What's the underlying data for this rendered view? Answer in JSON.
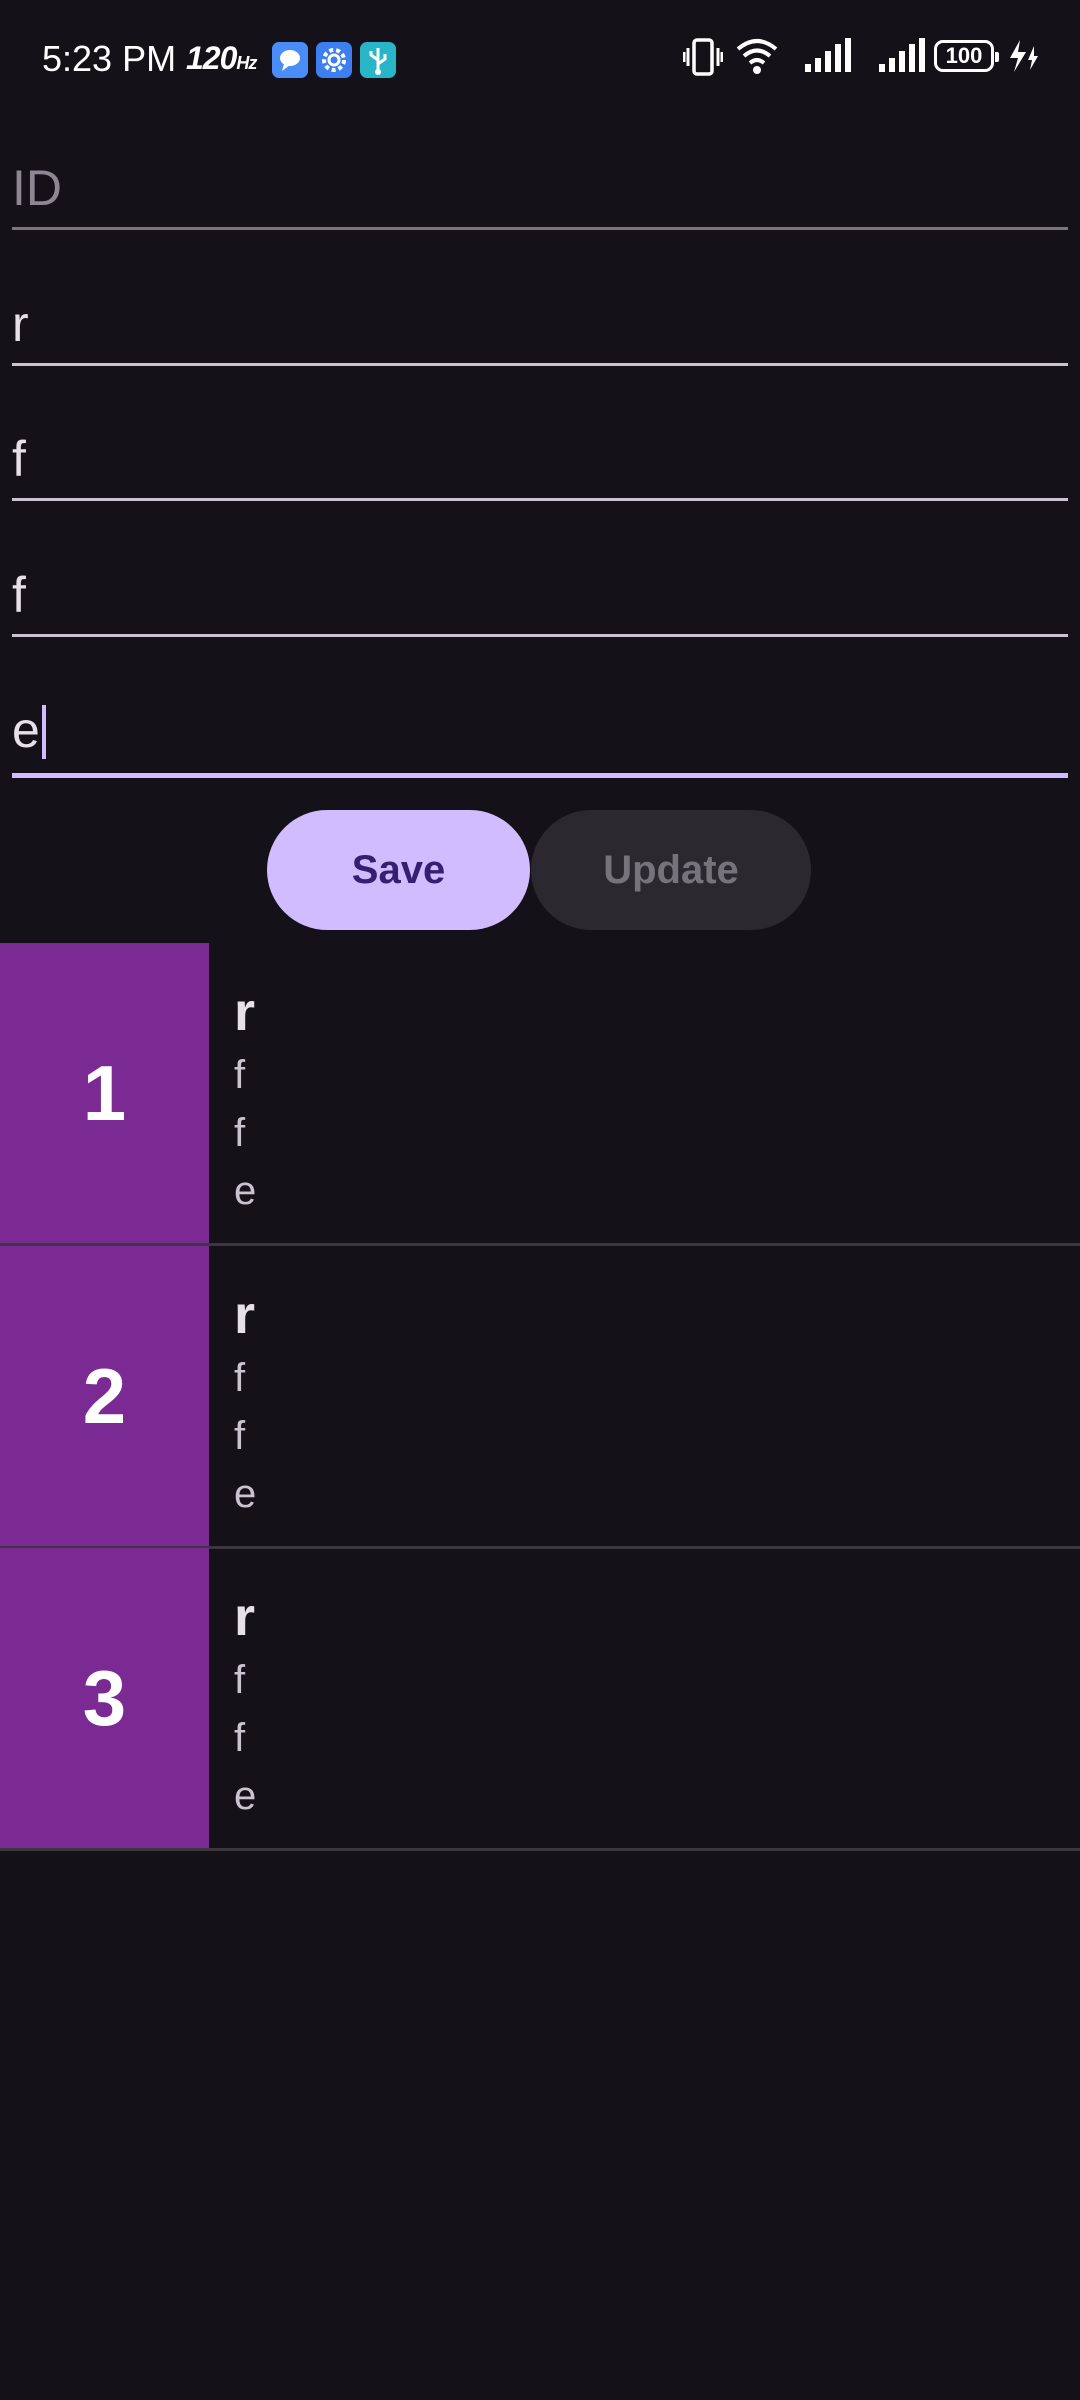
{
  "status_bar": {
    "time": "5:23 PM",
    "refresh_rate": "120",
    "refresh_unit": "Hz",
    "battery": "100",
    "icons": [
      "chat-bubble-icon",
      "settings-gear-icon",
      "usb-icon",
      "vibrate-icon",
      "wifi-icon",
      "signal-icon",
      "signal-icon-2",
      "battery-icon",
      "charging-icon"
    ],
    "colors": {
      "chat": "#4a8df8",
      "gear": "#3d7ff0",
      "usb": "#28b5c8"
    }
  },
  "form": {
    "id_placeholder": "ID",
    "field1_value": "r",
    "field2_value": "f",
    "field3_value": "f",
    "field4_value": "e",
    "save_label": "Save",
    "update_label": "Update"
  },
  "list": {
    "items": [
      {
        "id": "1",
        "title": "r",
        "line1": "f",
        "line2": "f",
        "line3": "e"
      },
      {
        "id": "2",
        "title": "r",
        "line1": "f",
        "line2": "f",
        "line3": "e"
      },
      {
        "id": "3",
        "title": "r",
        "line1": "f",
        "line2": "f",
        "line3": "e"
      }
    ]
  },
  "colors": {
    "background": "#141218",
    "accent": "#d0bcff",
    "id_box": "#7b2a93"
  }
}
